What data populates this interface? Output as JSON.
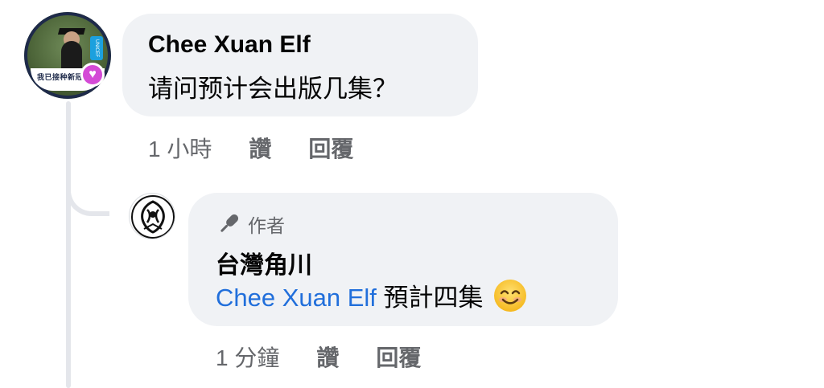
{
  "comment": {
    "author": "Chee Xuan Elf",
    "text": "请问预计会出版几集？",
    "avatar_frame_text": "我已接种新冠疫苗",
    "avatar_badge_icon": "heart-icon",
    "actions": {
      "time": "1 小時",
      "like": "讚",
      "reply": "回覆"
    }
  },
  "reply": {
    "badge_icon": "microphone-icon",
    "badge_label": "作者",
    "author": "台灣角川",
    "mention": "Chee Xuan Elf",
    "text": " 預計四集",
    "emoji": "smiling-face-emoji",
    "actions": {
      "time": "1 分鐘",
      "like": "讚",
      "reply": "回覆"
    }
  },
  "colors": {
    "bubble": "#f0f2f5",
    "mention": "#216fdb",
    "secondary_text": "#65676b",
    "thread_line": "#e4e6eb"
  }
}
